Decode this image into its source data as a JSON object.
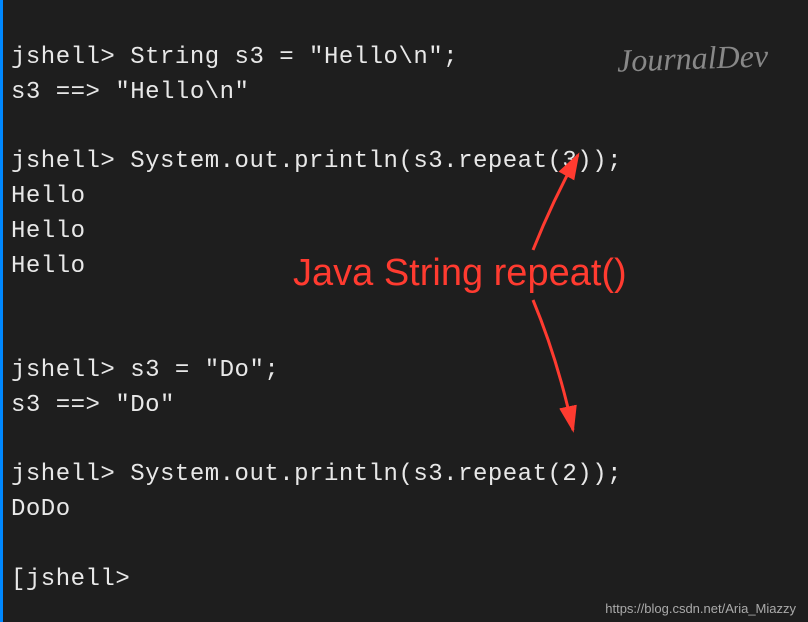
{
  "terminal": {
    "lines": [
      "jshell> String s3 = \"Hello\\n\";",
      "s3 ==> \"Hello\\n\"",
      "",
      "jshell> System.out.println(s3.repeat(3));",
      "Hello",
      "Hello",
      "Hello",
      "",
      "",
      "jshell> s3 = \"Do\";",
      "s3 ==> \"Do\"",
      "",
      "jshell> System.out.println(s3.repeat(2));",
      "DoDo",
      "",
      "[jshell>"
    ]
  },
  "annotation": {
    "label": "Java String repeat()"
  },
  "watermark": {
    "text": "JournalDev"
  },
  "footer": {
    "url": "https://blog.csdn.net/Aria_Miazzy"
  }
}
